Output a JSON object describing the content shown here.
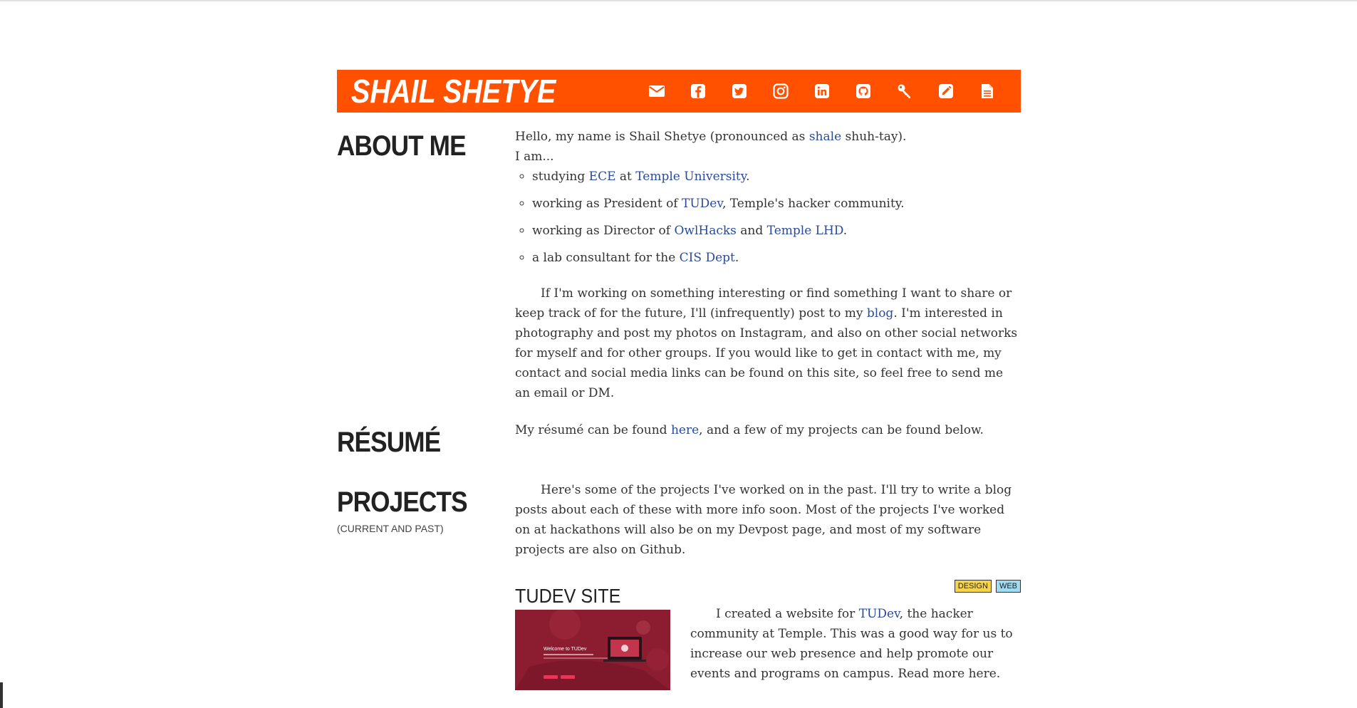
{
  "header": {
    "title": "SHAIL SHETYE",
    "brand_color": "#ff5100",
    "icons": [
      "envelope-icon",
      "facebook-icon",
      "twitter-icon",
      "instagram-icon",
      "linkedin-icon",
      "github-icon",
      "key-icon",
      "pencil-icon",
      "document-icon"
    ]
  },
  "about": {
    "heading": "ABOUT ME",
    "intro_pre": "Hello, my name is Shail Shetye (pronounced as ",
    "intro_link": "shale",
    "intro_post": " shuh-tay).",
    "i_am": "I am...",
    "items": [
      {
        "pre": "studying ",
        "link1": "ECE",
        "mid": " at ",
        "link2": "Temple University",
        "post": "."
      },
      {
        "pre": "working as President of ",
        "link1": "TUDev",
        "post": ", Temple's hacker community."
      },
      {
        "pre": "working as Director of ",
        "link1": "OwlHacks",
        "mid": " and ",
        "link2": "Temple LHD",
        "post": "."
      },
      {
        "pre": "a lab consultant for the ",
        "link1": "CIS Dept",
        "post": "."
      }
    ],
    "para_pre": "If I'm working on something interesting or find something I want to share or keep track of for the future, I'll (infrequently) post to my ",
    "para_link": "blog",
    "para_post": ". I'm interested in photography and post my photos on Instagram, and also on other social networks for myself and for other groups. If you would like to get in contact with me, my contact and social media links can be found on this site, so feel free to send me an email or DM."
  },
  "resume": {
    "heading": "RÉSUMÉ",
    "text_pre": "My résumé can be found ",
    "text_link": "here",
    "text_post": ", and a few of my projects can be found below."
  },
  "projects": {
    "heading": "PROJECTS",
    "subheading": "(current and past)",
    "intro": "Here's some of the projects I've worked on in the past. I'll try to write a blog posts about each of these with more info soon. Most of the projects I've worked on at hackathons will also be on my Devpost page, and most of my software projects are also on Github.",
    "items": [
      {
        "title": "TUDEV SITE",
        "tags": [
          {
            "label": "design",
            "color": "#f5d44a"
          },
          {
            "label": "web",
            "color": "#9fdcf2"
          }
        ],
        "thumb_text": "Welcome to TUDev",
        "desc_pre": "I created a website for ",
        "desc_link": "TUDev",
        "desc_post": ", the hacker community at Temple. This was a good way for us to increase our web presence and help promote our events and programs on campus. Read more here."
      }
    ]
  }
}
